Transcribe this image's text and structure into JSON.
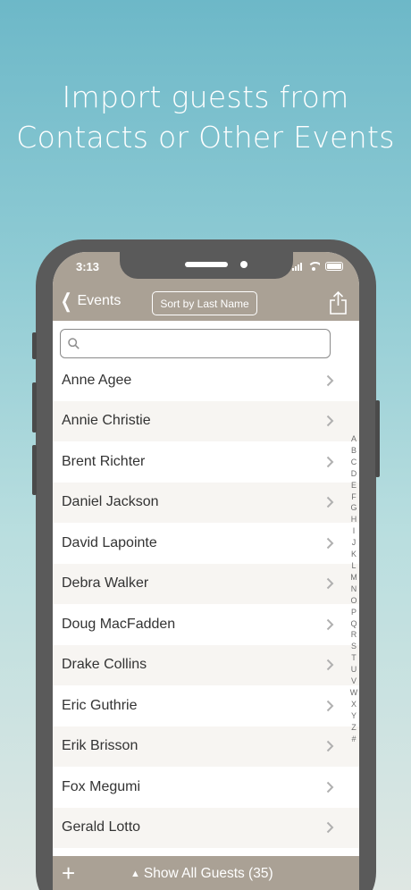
{
  "headline": {
    "line1": "Import guests from",
    "line2": "Contacts or Other Events"
  },
  "status": {
    "time": "3:13"
  },
  "nav": {
    "back_label": "Events",
    "sort_label": "Sort by Last Name"
  },
  "search": {
    "placeholder": ""
  },
  "guests": [
    "Anne Agee",
    "Annie Christie",
    "Brent Richter",
    "Daniel Jackson",
    "David Lapointe",
    "Debra Walker",
    "Doug MacFadden",
    "Drake Collins",
    "Eric Guthrie",
    "Erik Brisson",
    "Fox Megumi",
    "Gerald Lotto"
  ],
  "index_letters": [
    "A",
    "B",
    "C",
    "D",
    "E",
    "F",
    "G",
    "H",
    "I",
    "J",
    "K",
    "L",
    "M",
    "N",
    "O",
    "P",
    "Q",
    "R",
    "S",
    "T",
    "U",
    "V",
    "W",
    "X",
    "Y",
    "Z",
    "#"
  ],
  "bottom": {
    "add_label": "+",
    "show_all_label": "Show All Guests (35)"
  },
  "colors": {
    "bar": "#aaa195",
    "alt_row": "#f7f5f2",
    "phone_frame": "#5a5a5a"
  }
}
